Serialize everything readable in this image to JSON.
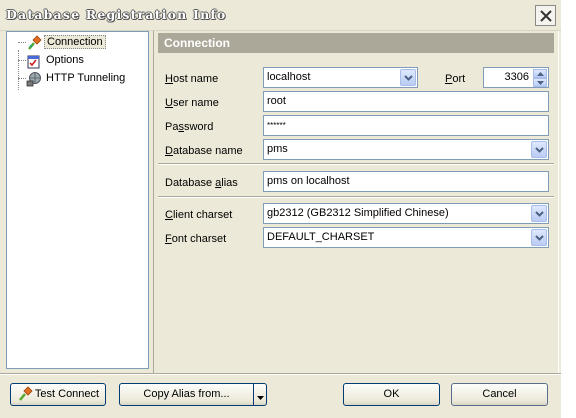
{
  "window": {
    "title": "Database Registration Info"
  },
  "tree": {
    "items": [
      {
        "label": "Connection"
      },
      {
        "label": "Options"
      },
      {
        "label": "HTTP Tunneling"
      }
    ]
  },
  "connection": {
    "header": "Connection",
    "host": {
      "label_pre": "",
      "label_ul": "H",
      "label_post": "ost name",
      "value": "localhost"
    },
    "port": {
      "label_pre": "",
      "label_ul": "P",
      "label_post": "ort",
      "value": "3306"
    },
    "user": {
      "label_pre": "",
      "label_ul": "U",
      "label_post": "ser name",
      "value": "root"
    },
    "password": {
      "label_pre": "Pa",
      "label_ul": "s",
      "label_post": "sword",
      "value": "******"
    },
    "database": {
      "label_pre": "",
      "label_ul": "D",
      "label_post": "atabase name",
      "value": "pms"
    },
    "alias": {
      "label_pre": "Database ",
      "label_ul": "a",
      "label_post": "lias",
      "value": "pms on localhost"
    },
    "client_charset": {
      "label_pre": "",
      "label_ul": "C",
      "label_post": "lient charset",
      "value": "gb2312 (GB2312 Simplified Chinese)"
    },
    "font_charset": {
      "label_pre": "",
      "label_ul": "F",
      "label_post": "ont charset",
      "value": "DEFAULT_CHARSET"
    }
  },
  "buttons": {
    "test_connect": "Test Connect",
    "copy_alias": "Copy Alias from...",
    "ok": "OK",
    "cancel": "Cancel"
  }
}
